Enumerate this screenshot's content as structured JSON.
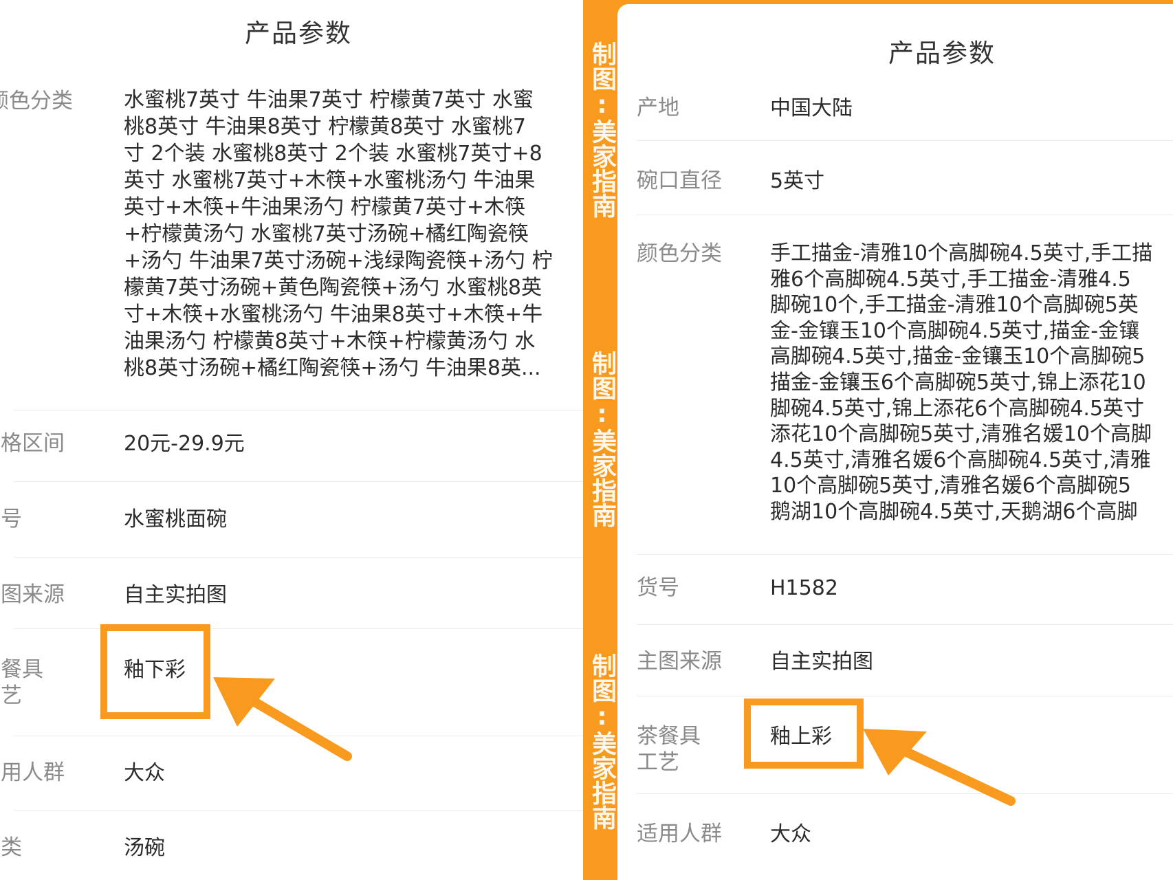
{
  "left": {
    "title": "产品参数",
    "rows": [
      {
        "label": "颜色分类",
        "value_lines": [
          "水蜜桃7英寸 牛油果7英寸 柠檬黄7英寸 水蜜",
          "桃8英寸 牛油果8英寸 柠檬黄8英寸 水蜜桃7",
          "寸 2个装 水蜜桃8英寸 2个装 水蜜桃7英寸+8",
          "英寸 水蜜桃7英寸+木筷+水蜜桃汤勺 牛油果",
          "英寸+木筷+牛油果汤勺 柠檬黄7英寸+木筷",
          "+柠檬黄汤勺 水蜜桃7英寸汤碗+橘红陶瓷筷",
          "+汤勺 牛油果7英寸汤碗+浅绿陶瓷筷+汤勺 柠",
          "檬黄7英寸汤碗+黄色陶瓷筷+汤勺 水蜜桃8英",
          "寸+木筷+水蜜桃汤勺 牛油果8英寸+木筷+牛",
          "油果汤勺 柠檬黄8英寸+木筷+柠檬黄汤勺 水",
          "桃8英寸汤碗+橘红陶瓷筷+汤勺 牛油果8英..."
        ]
      },
      {
        "label": "价格区间",
        "value": "20元-29.9元"
      },
      {
        "label": "货号",
        "value": "水蜜桃面碗"
      },
      {
        "label": "主图来源",
        "value": "自主实拍图"
      },
      {
        "label_lines": [
          "茶餐具",
          "工艺"
        ],
        "value": "釉下彩"
      },
      {
        "label": "适用人群",
        "value": "大众"
      },
      {
        "label": "分类",
        "value": "汤碗"
      }
    ]
  },
  "right": {
    "title": "产品参数",
    "rows": [
      {
        "label": "产地",
        "value": "中国大陆"
      },
      {
        "label": "碗口直径",
        "value": "5英寸"
      },
      {
        "label": "颜色分类",
        "value_lines": [
          "手工描金-清雅10个高脚碗4.5英寸,手工描",
          "雅6个高脚碗4.5英寸,手工描金-清雅4.5",
          "脚碗10个,手工描金-清雅10个高脚碗5英",
          "金-金镶玉10个高脚碗4.5英寸,描金-金镶",
          "高脚碗4.5英寸,描金-金镶玉10个高脚碗5",
          "描金-金镶玉6个高脚碗5英寸,锦上添花10",
          "脚碗4.5英寸,锦上添花6个高脚碗4.5英寸",
          "添花10个高脚碗5英寸,清雅名媛10个高脚",
          "4.5英寸,清雅名媛6个高脚碗4.5英寸,清雅",
          "10个高脚碗5英寸,清雅名媛6个高脚碗5",
          "鹅湖10个高脚碗4.5英寸,天鹅湖6个高脚"
        ]
      },
      {
        "label": "货号",
        "value": "H1582"
      },
      {
        "label": "主图来源",
        "value": "自主实拍图"
      },
      {
        "label_lines": [
          "茶餐具",
          "工艺"
        ],
        "value": "釉上彩"
      },
      {
        "label": "适用人群",
        "value": "大众"
      }
    ]
  },
  "watermark": [
    "制图:美家指南",
    "制图:美家指南",
    "制图:美家指南"
  ],
  "colors": {
    "accent": "#f79a1d",
    "label": "#8a8a8a",
    "text": "#2b2b2b"
  },
  "icons": [
    "arrow-left-pointer-icon",
    "arrow-right-pointer-icon"
  ]
}
